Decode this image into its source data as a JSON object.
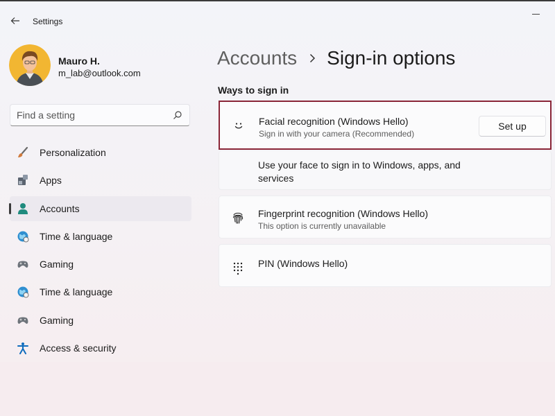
{
  "window": {
    "title": "Settings"
  },
  "user": {
    "name": "Mauro H.",
    "email": "m_lab@outlook.com"
  },
  "search": {
    "placeholder": "Find a setting"
  },
  "nav": {
    "items": [
      {
        "label": "Personalization",
        "icon": "paintbrush-icon"
      },
      {
        "label": "Apps",
        "icon": "apps-icon"
      },
      {
        "label": "Accounts",
        "icon": "person-icon",
        "selected": true
      },
      {
        "label": "Time & language",
        "icon": "globe-clock-icon"
      },
      {
        "label": "Gaming",
        "icon": "gamepad-icon"
      },
      {
        "label": "Time & language",
        "icon": "globe-clock-icon"
      },
      {
        "label": "Gaming",
        "icon": "gamepad-icon"
      },
      {
        "label": "Access & security",
        "icon": "accessibility-icon"
      }
    ]
  },
  "breadcrumb": {
    "parent": "Accounts",
    "current": "Sign-in options"
  },
  "section": {
    "title": "Ways to sign in"
  },
  "sign_in_options": {
    "facial": {
      "title": "Facial recognition (Windows Hello)",
      "subtitle": "Sign in with your camera (Recommended)",
      "button": "Set up",
      "detail": "Use your face to sign in to Windows, apps, and services"
    },
    "fingerprint": {
      "title": "Fingerprint recognition (Windows Hello)",
      "subtitle": "This option is currently unavailable"
    },
    "pin": {
      "title": "PIN (Windows Hello)"
    }
  },
  "colors": {
    "highlight_border": "#8a2537",
    "accent_blue": "#0f6cbd",
    "accounts_icon": "#1f8b7e"
  }
}
